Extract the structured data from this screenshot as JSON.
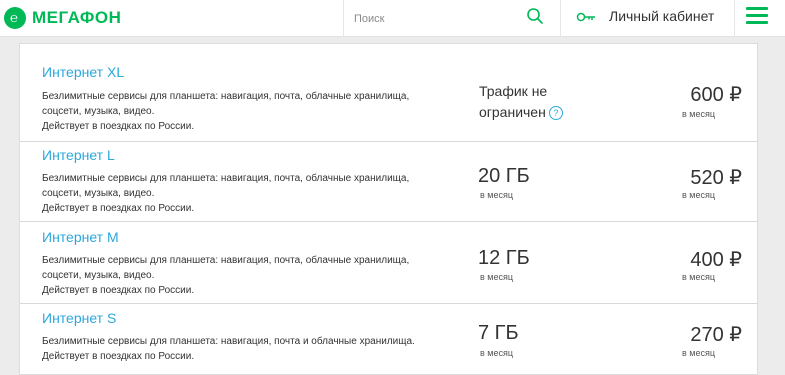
{
  "header": {
    "logo_text": "МегаФон",
    "search": {
      "placeholder": "Поиск",
      "value": ""
    },
    "account_label": "Личный кабинет"
  },
  "colors": {
    "brand": "#00b956",
    "link": "#2ba8dc"
  },
  "tariffs": [
    {
      "name": "Интернет XL",
      "desc_line1": "Безлимитные сервисы для планшета: навигация, почта, облачные хранилища,",
      "desc_line2": "соцсети, музыка, видео.",
      "desc_line3": "Действует в поездках по России.",
      "traffic_line1": "Трафик не",
      "traffic_line2": "ограничен",
      "price": "600 ₽",
      "price_unit": "в месяц"
    },
    {
      "name": "Интернет L",
      "desc_line1": "Безлимитные сервисы для планшета: навигация, почта, облачные хранилища,",
      "desc_line2": "соцсети, музыка, видео.",
      "desc_line3": "Действует в поездках по России.",
      "traffic": "20 ГБ",
      "traffic_unit": "в месяц",
      "price": "520 ₽",
      "price_unit": "в месяц"
    },
    {
      "name": "Интернет M",
      "desc_line1": "Безлимитные сервисы для планшета: навигация, почта, облачные хранилища,",
      "desc_line2": "соцсети, музыка, видео.",
      "desc_line3": "Действует в поездках по России.",
      "traffic": "12 ГБ",
      "traffic_unit": "в месяц",
      "price": "400 ₽",
      "price_unit": "в месяц"
    },
    {
      "name": "Интернет S",
      "desc_line1": "Безлимитные сервисы для планшета: навигация, почта и облачные хранилища.",
      "desc_line2": "Действует в поездках по России.",
      "traffic": "7 ГБ",
      "traffic_unit": "в месяц",
      "price": "270 ₽",
      "price_unit": "в месяц"
    }
  ]
}
